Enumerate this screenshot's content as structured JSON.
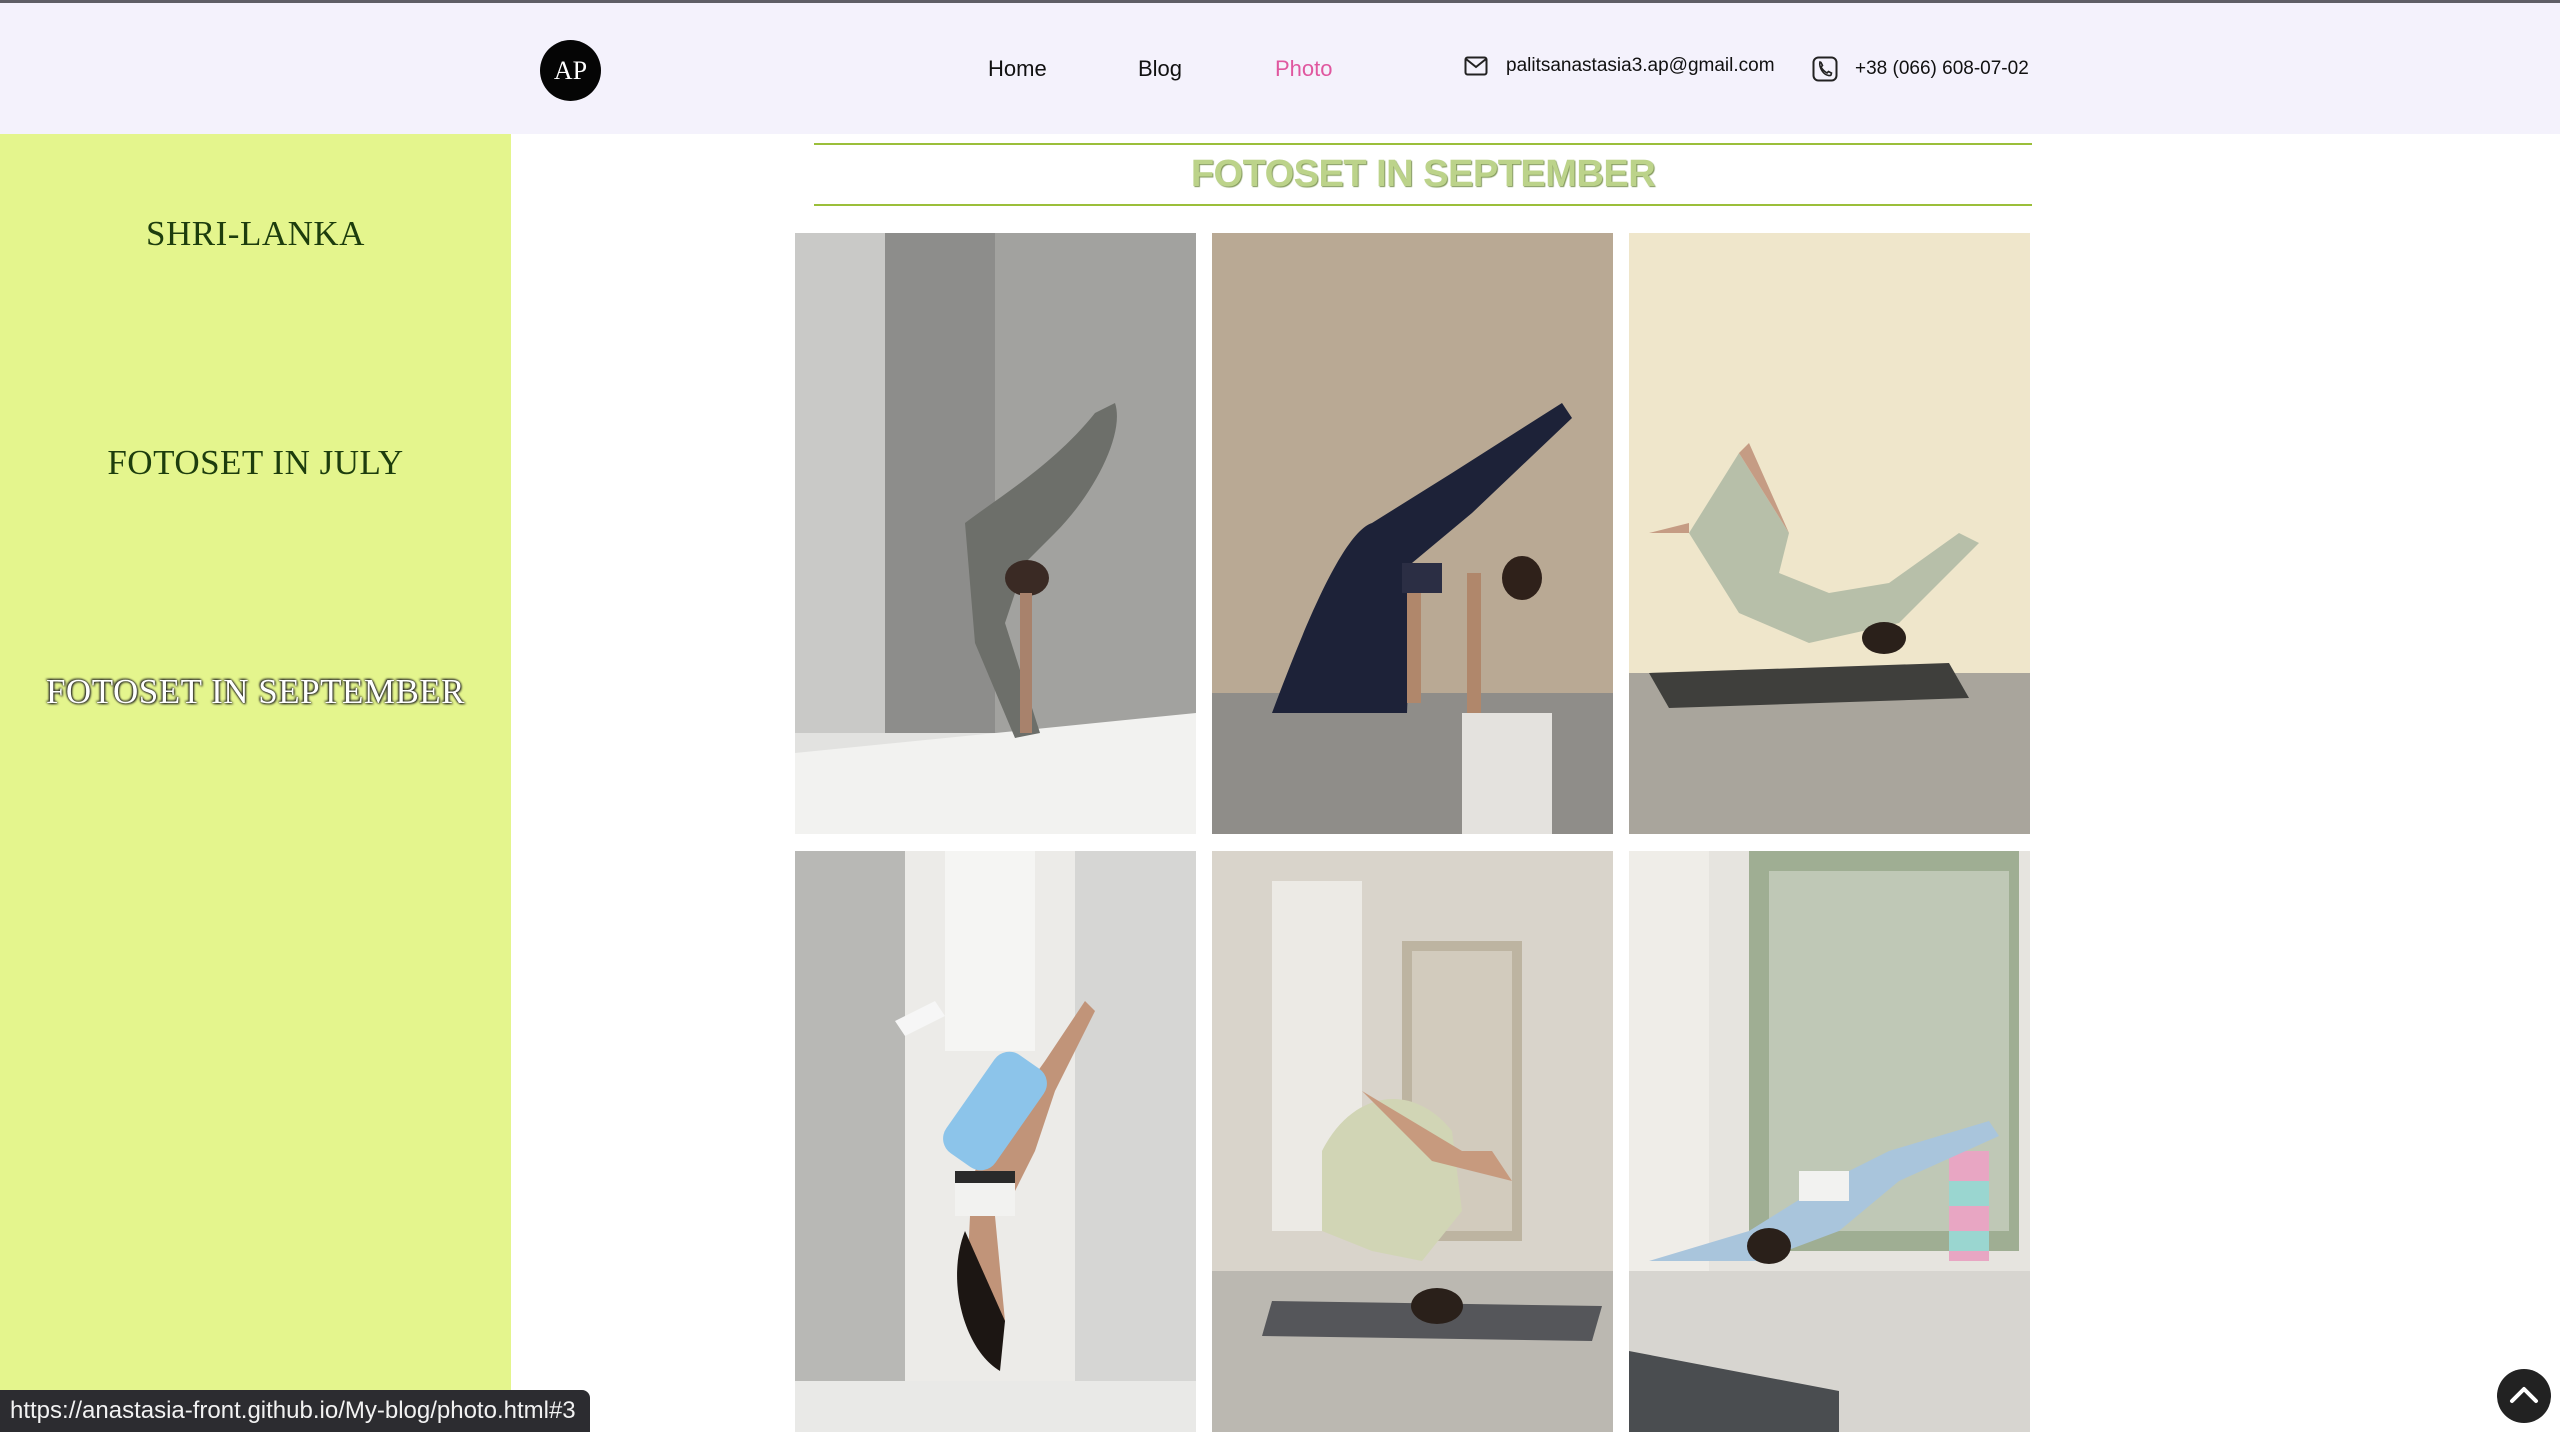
{
  "header": {
    "logo": "AP",
    "nav": [
      {
        "label": "Home",
        "active": false
      },
      {
        "label": "Blog",
        "active": false
      },
      {
        "label": "Photo",
        "active": true
      }
    ],
    "email": "palitsanastasia3.ap@gmail.com",
    "phone": "+38 (066) 608-07-02",
    "icons": {
      "email": "envelope-icon",
      "phone": "phone-icon"
    }
  },
  "sidebar": {
    "items": [
      {
        "label": "SHRI-LANKA"
      },
      {
        "label": "FOTOSET IN JULY"
      },
      {
        "label": "FOTOSET IN SEPTEMBER"
      }
    ]
  },
  "main": {
    "section_title": "FOTOSET IN SEPTEMBER",
    "photos": [
      "photo-1",
      "photo-2",
      "photo-3",
      "photo-4",
      "photo-5",
      "photo-6"
    ]
  },
  "status": {
    "url": "https://anastasia-front.github.io/My-blog/photo.html#3"
  },
  "colors": {
    "header_bg": "#f4f2fc",
    "sidebar_bg": "#e4f58d",
    "active_nav": "#e0579f",
    "title": "#bcd38a",
    "rule": "#9bbf3a"
  }
}
